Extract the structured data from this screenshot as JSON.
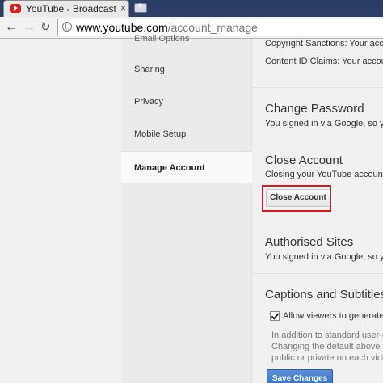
{
  "browser": {
    "tab_title": "YouTube - Broadcast Yours",
    "tab_close": "×",
    "new_tab": "+",
    "url_host": "www.youtube.com",
    "url_path": "/account_manage"
  },
  "sidebar": {
    "items": [
      {
        "label": "Email Options"
      },
      {
        "label": "Sharing"
      },
      {
        "label": "Privacy"
      },
      {
        "label": "Mobile Setup"
      },
      {
        "label": "Manage Account",
        "active": true
      }
    ]
  },
  "main": {
    "copyright_line": "Copyright Sanctions: Your account i",
    "contentid_line": "Content ID Claims: Your account in",
    "change_password": {
      "heading": "Change Password",
      "text": "You signed in via Google, so you s"
    },
    "close_account": {
      "heading": "Close Account",
      "text": "Closing your YouTube account wil",
      "button": "Close Account"
    },
    "authorised_sites": {
      "heading": "Authorised Sites",
      "text": "You signed in via Google, so you s"
    },
    "captions": {
      "heading": "Captions and Subtitles",
      "checkbox_label": "Allow viewers to generate ca",
      "checkbox_checked": true,
      "help_lines": [
        "In addition to standard user-uple",
        "Changing the default above will",
        "public or private on each video's"
      ]
    },
    "save_button": "Save Changes"
  },
  "colors": {
    "highlight": "#d7191c",
    "save_button": "#3b78cf"
  }
}
